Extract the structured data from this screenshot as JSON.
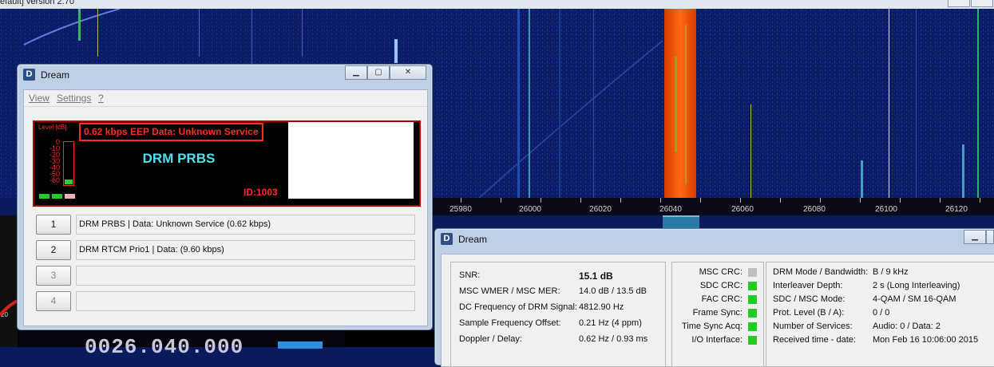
{
  "background_app": {
    "title_fragment": "efault]  version 2.70",
    "frequency_axis_labels": [
      "25980",
      "26000",
      "26020",
      "26040",
      "26060",
      "26080",
      "26100",
      "26120"
    ],
    "meter_scale_fragment": "20",
    "frequency_readout_fragment": "0026.040.000"
  },
  "dream_main": {
    "window_title": "Dream",
    "menu": {
      "view": "View",
      "settings": "Settings",
      "help": "?"
    },
    "display": {
      "level_label": "Level [dB]",
      "scale": [
        "0",
        "-10",
        "-20",
        "-30",
        "-40",
        "-50",
        "-60"
      ],
      "level_fraction": 0.12,
      "status_text": "0.62 kbps EEP  Data:  Unknown Service",
      "service_name": "DRM PRBS",
      "id_text": "ID:1003",
      "led_colors": [
        "#22cc22",
        "#22cc22",
        "#f3b0b0"
      ]
    },
    "services": [
      {
        "number": "1",
        "label": "DRM PRBS  |   Data: Unknown Service (0.62 kbps)",
        "enabled": true
      },
      {
        "number": "2",
        "label": "DRM RTCM Prio1  |   Data:  (9.60 kbps)",
        "enabled": true
      },
      {
        "number": "3",
        "label": "",
        "enabled": false
      },
      {
        "number": "4",
        "label": "",
        "enabled": false
      }
    ]
  },
  "dream_status": {
    "window_title": "Dream",
    "measurements": [
      {
        "label": "SNR:",
        "value": "15.1 dB",
        "bold": true
      },
      {
        "label": "MSC WMER / MSC MER:",
        "value": "14.0 dB / 13.5 dB"
      },
      {
        "label": "DC Frequency of DRM Signal:",
        "value": "4812.90 Hz"
      },
      {
        "label": "Sample Frequency Offset:",
        "value": "0.21 Hz (4 ppm)"
      },
      {
        "label": "Doppler / Delay:",
        "value": "0.62 Hz / 0.93 ms"
      }
    ],
    "indicators": [
      {
        "label": "MSC CRC:",
        "color": "#c0c0c0"
      },
      {
        "label": "SDC CRC:",
        "color": "#22cc22"
      },
      {
        "label": "FAC CRC:",
        "color": "#22cc22"
      },
      {
        "label": "Frame Sync:",
        "color": "#22cc22"
      },
      {
        "label": "Time Sync Acq:",
        "color": "#22cc22"
      },
      {
        "label": "I/O Interface:",
        "color": "#22cc22"
      }
    ],
    "parameters": [
      {
        "label": "DRM Mode / Bandwidth:",
        "value": "B / 9 kHz"
      },
      {
        "label": "Interleaver Depth:",
        "value": "2 s (Long Interleaving)"
      },
      {
        "label": "SDC / MSC Mode:",
        "value": "4-QAM / SM 16-QAM"
      },
      {
        "label": "Prot. Level (B / A):",
        "value": "0 / 0"
      },
      {
        "label": "Number of Services:",
        "value": "Audio: 0 / Data: 2"
      },
      {
        "label": "Received time - date:",
        "value": "Mon Feb 16 10:06:00 2015"
      }
    ]
  }
}
